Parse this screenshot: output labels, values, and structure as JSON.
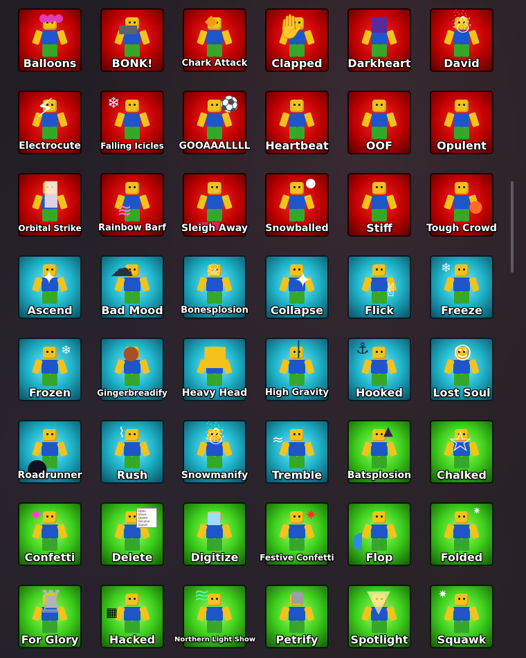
{
  "colors": {
    "red": "#c00000",
    "blue": "#1fb3c9",
    "green": "#3fd11d"
  },
  "emotes": [
    {
      "label": "Balloons",
      "color": "red",
      "icon": "balloons-icon"
    },
    {
      "label": "BONK!",
      "color": "red",
      "icon": "hammer-icon"
    },
    {
      "label": "Chark Attack",
      "color": "red",
      "icon": "shark-icon"
    },
    {
      "label": "Clapped",
      "color": "red",
      "icon": "clapping-hands-icon"
    },
    {
      "label": "Darkheart",
      "color": "red",
      "icon": "dark-figure-icon"
    },
    {
      "label": "David",
      "color": "red",
      "icon": "snowman-icon"
    },
    {
      "label": "Electrocute",
      "color": "red",
      "icon": "lightning-skeleton-icon"
    },
    {
      "label": "Falling Icicles",
      "color": "red",
      "icon": "icicle-icon"
    },
    {
      "label": "GOOAAALLLL",
      "color": "red",
      "icon": "soccer-ball-icon"
    },
    {
      "label": "Heartbeat",
      "color": "red",
      "icon": "figure-icon"
    },
    {
      "label": "OOF",
      "color": "red",
      "icon": "fallen-figure-icon"
    },
    {
      "label": "Opulent",
      "color": "red",
      "icon": "golden-figure-icon"
    },
    {
      "label": "Orbital Strike",
      "color": "red",
      "icon": "beam-icon"
    },
    {
      "label": "Rainbow Barf",
      "color": "red",
      "icon": "rainbow-icon"
    },
    {
      "label": "Sleigh Away",
      "color": "red",
      "icon": "sleigh-icon"
    },
    {
      "label": "Snowballed",
      "color": "red",
      "icon": "snowball-icon"
    },
    {
      "label": "Stiff",
      "color": "red",
      "icon": "t-pose-icon"
    },
    {
      "label": "Tough Crowd",
      "color": "red",
      "icon": "tomato-icon"
    },
    {
      "label": "Ascend",
      "color": "blue",
      "icon": "glowing-figure-icon"
    },
    {
      "label": "Bad Mood",
      "color": "blue",
      "icon": "storm-cloud-icon"
    },
    {
      "label": "Bonesplosion",
      "color": "blue",
      "icon": "bone-icon"
    },
    {
      "label": "Collapse",
      "color": "blue",
      "icon": "sparkle-icon"
    },
    {
      "label": "Flick",
      "color": "blue",
      "icon": "flicking-hand-icon"
    },
    {
      "label": "Freeze",
      "color": "blue",
      "icon": "ice-figure-icon"
    },
    {
      "label": "Frozen",
      "color": "blue",
      "icon": "frozen-figure-icon"
    },
    {
      "label": "Gingerbreadify",
      "color": "blue",
      "icon": "gingerbread-icon"
    },
    {
      "label": "Heavy Head",
      "color": "blue",
      "icon": "big-head-icon"
    },
    {
      "label": "High Gravity",
      "color": "blue",
      "icon": "crouching-figure-icon"
    },
    {
      "label": "Hooked",
      "color": "blue",
      "icon": "hook-icon"
    },
    {
      "label": "Lost Soul",
      "color": "blue",
      "icon": "ghost-icon"
    },
    {
      "label": "Roadrunner",
      "color": "blue",
      "icon": "hole-icon"
    },
    {
      "label": "Rush",
      "color": "blue",
      "icon": "shocked-head-icon"
    },
    {
      "label": "Snowmanify",
      "color": "blue",
      "icon": "snowman-icon"
    },
    {
      "label": "Tremble",
      "color": "blue",
      "icon": "trembling-figure-icon"
    },
    {
      "label": "Batsplosion",
      "color": "green",
      "icon": "bat-icon"
    },
    {
      "label": "Chalked",
      "color": "green",
      "icon": "chalk-outline-icon"
    },
    {
      "label": "Confetti",
      "color": "green",
      "icon": "confetti-icon"
    },
    {
      "label": "Delete",
      "color": "green",
      "icon": "context-menu-icon"
    },
    {
      "label": "Digitize",
      "color": "green",
      "icon": "digital-figure-icon"
    },
    {
      "label": "Festive Confetti",
      "color": "green",
      "icon": "festive-confetti-icon"
    },
    {
      "label": "Flop",
      "color": "green",
      "icon": "fish-icon"
    },
    {
      "label": "Folded",
      "color": "green",
      "icon": "folded-figure-icon"
    },
    {
      "label": "For Glory",
      "color": "green",
      "icon": "statue-icon"
    },
    {
      "label": "Hacked",
      "color": "green",
      "icon": "glitch-figure-icon"
    },
    {
      "label": "Northern Light Show",
      "color": "green",
      "icon": "aurora-icon"
    },
    {
      "label": "Petrify",
      "color": "green",
      "icon": "stone-figure-icon"
    },
    {
      "label": "Spotlight",
      "color": "green",
      "icon": "spotlight-icon"
    },
    {
      "label": "Squawk",
      "color": "green",
      "icon": "bird-icon"
    }
  ],
  "delete_menu": [
    "Open",
    "Share",
    "Delete",
    "Rename",
    "Export"
  ]
}
